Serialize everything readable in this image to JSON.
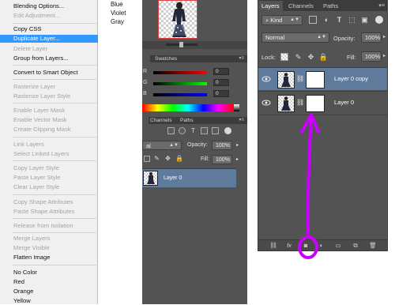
{
  "context_menu": {
    "items": [
      {
        "label": "Blending Options...",
        "state": "normal"
      },
      {
        "label": "Edit Adjustment...",
        "state": "disabled"
      },
      {
        "label": "Copy CSS",
        "state": "normal"
      },
      {
        "label": "Duplicate Layer...",
        "state": "highlighted"
      },
      {
        "label": "Delete Layer",
        "state": "disabled"
      },
      {
        "label": "Group from Layers...",
        "state": "normal"
      },
      {
        "label": "Convert to Smart Object",
        "state": "normal"
      },
      {
        "label": "Rasterize Layer",
        "state": "disabled"
      },
      {
        "label": "Rasterize Layer Style",
        "state": "disabled"
      },
      {
        "label": "Enable Layer Mask",
        "state": "disabled"
      },
      {
        "label": "Enable Vector Mask",
        "state": "disabled"
      },
      {
        "label": "Create Clipping Mask",
        "state": "disabled"
      },
      {
        "label": "Link Layers",
        "state": "disabled"
      },
      {
        "label": "Select Linked Layers",
        "state": "disabled"
      },
      {
        "label": "Copy Layer Style",
        "state": "disabled"
      },
      {
        "label": "Paste Layer Style",
        "state": "disabled"
      },
      {
        "label": "Clear Layer Style",
        "state": "disabled"
      },
      {
        "label": "Copy Shape Attributes",
        "state": "disabled"
      },
      {
        "label": "Paste Shape Attributes",
        "state": "disabled"
      },
      {
        "label": "Release from Isolation",
        "state": "disabled"
      },
      {
        "label": "Merge Layers",
        "state": "disabled"
      },
      {
        "label": "Merge Visible",
        "state": "disabled"
      },
      {
        "label": "Flatten Image",
        "state": "normal"
      },
      {
        "label": "No Color",
        "state": "normal"
      },
      {
        "label": "Red",
        "state": "normal"
      },
      {
        "label": "Orange",
        "state": "normal"
      },
      {
        "label": "Yellow",
        "state": "normal"
      }
    ],
    "color_submenu": [
      "Blue",
      "Violet",
      "Gray"
    ]
  },
  "mid_panel": {
    "swatches_tab": "Swatches",
    "r_label": "R",
    "g_label": "G",
    "b_label": "B",
    "r_value": "0",
    "g_value": "0",
    "b_value": "0",
    "tabs": [
      "Channels",
      "Paths"
    ],
    "blend_mode": "al",
    "opacity_label": "Opacity:",
    "opacity_value": "100%",
    "fill_label": "Fill:",
    "fill_value": "100%",
    "layer_name": "Layer 0"
  },
  "layers_panel": {
    "tabs": [
      "Layers",
      "Channels",
      "Paths"
    ],
    "filter_kind": "Kind",
    "blend_mode": "Normal",
    "opacity_label": "Opacity:",
    "opacity_value": "100%",
    "lock_label": "Lock:",
    "fill_label": "Fill:",
    "fill_value": "100%",
    "layers": [
      {
        "name": "Layer 0 copy",
        "selected": true
      },
      {
        "name": "Layer 0",
        "selected": false
      }
    ],
    "footer_fx": "fx"
  },
  "colors": {
    "highlight": "#3399ff",
    "selected_layer": "#5f7b9c",
    "annotation": "#cc00ff",
    "canvas_border": "#e04040"
  },
  "icons": [
    "eye-icon",
    "chain-link-icon",
    "add-mask-icon",
    "lock-icon",
    "brush-icon",
    "move-icon",
    "trash-icon",
    "new-layer-icon",
    "folder-icon",
    "adjustment-icon",
    "link-icon"
  ]
}
